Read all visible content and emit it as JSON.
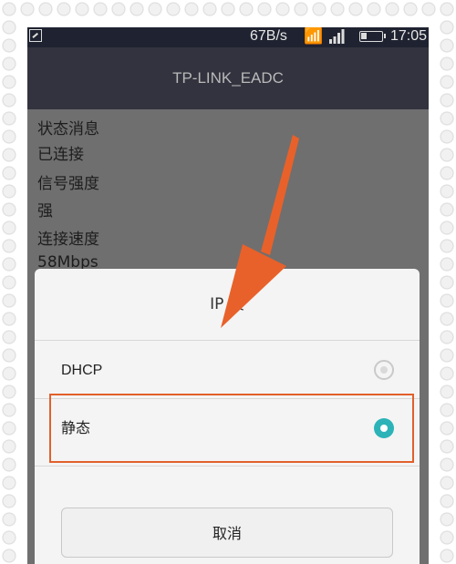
{
  "status_bar": {
    "speed": "67B/s",
    "time": "17:05",
    "icons": [
      "image-notification-icon",
      "wifi-icon",
      "cellular-signal-icon",
      "battery-icon"
    ]
  },
  "header": {
    "title": "TP-LINK_EADC"
  },
  "info": {
    "status_label": "状态消息",
    "status_value": "已连接",
    "signal_label": "信号强度",
    "signal_value": "强",
    "speed_label": "连接速度",
    "speed_value": "58Mbps"
  },
  "dialog": {
    "title": "IP 设",
    "options": [
      {
        "label": "DHCP",
        "selected": false
      },
      {
        "label": "静态",
        "selected": true
      }
    ],
    "cancel_label": "取消"
  },
  "colors": {
    "accent": "#2bb3b8",
    "annotation": "#e2602b",
    "title_bar": "#32333e"
  }
}
